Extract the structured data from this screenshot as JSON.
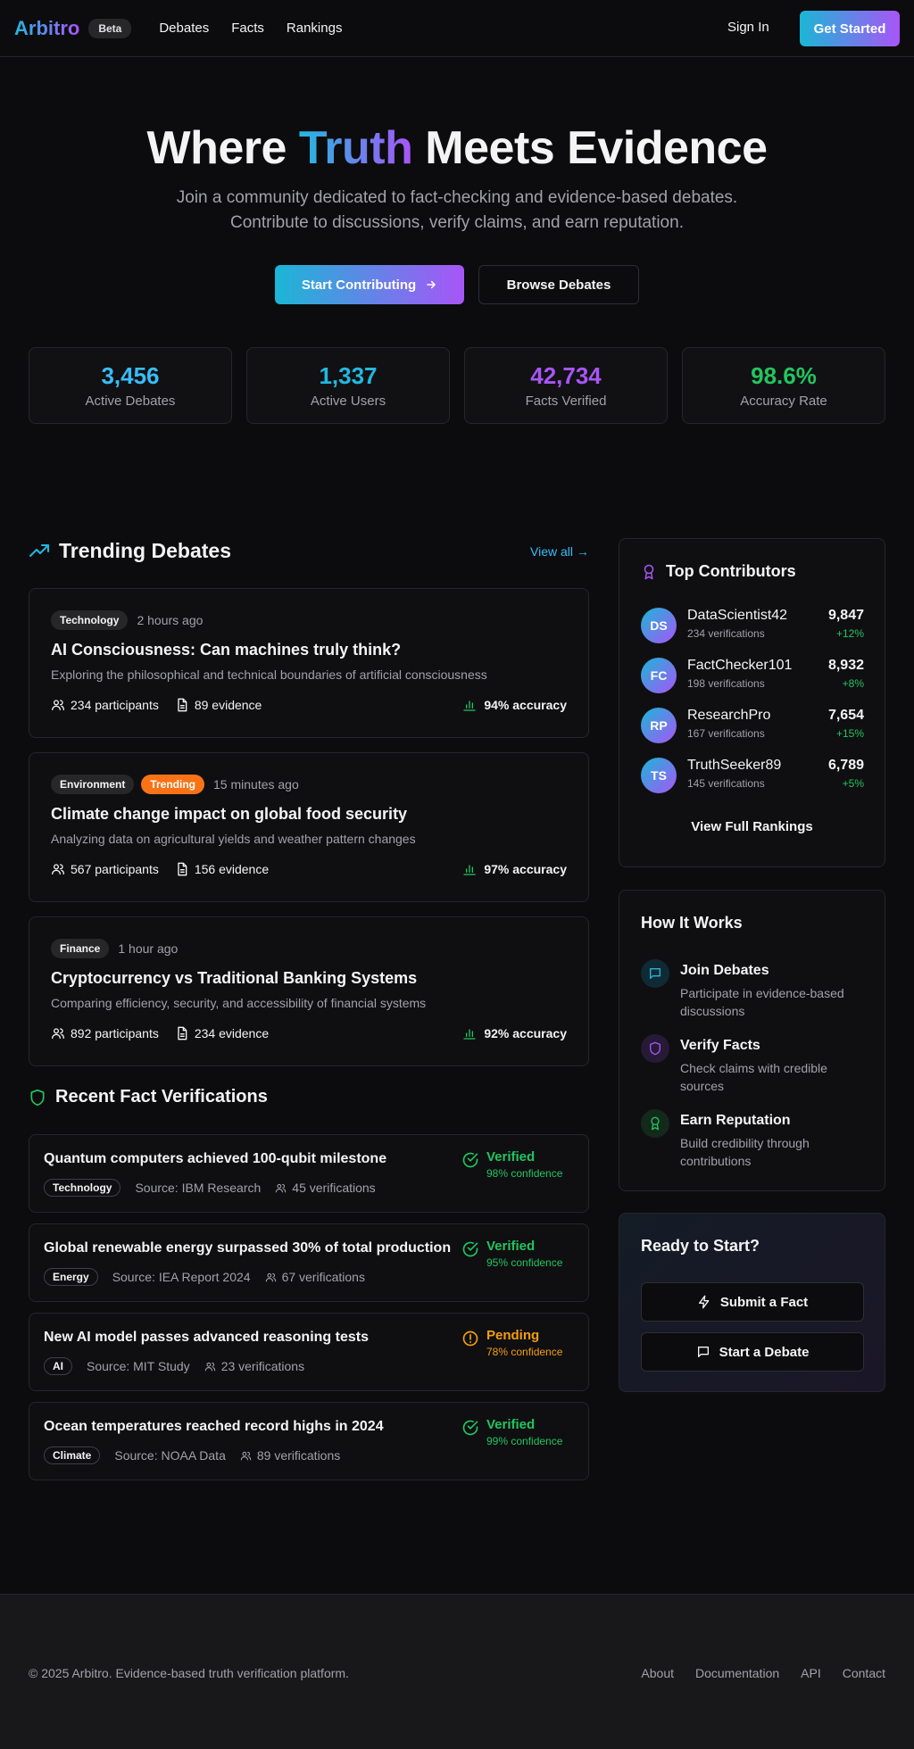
{
  "nav": {
    "logo": "Arbitro",
    "badge": "Beta",
    "links": [
      "Debates",
      "Facts",
      "Rankings"
    ],
    "sign_in": "Sign In",
    "get_started": "Get Started"
  },
  "hero": {
    "title_pre": "Where ",
    "title_accent": "Truth",
    "title_post": " Meets Evidence",
    "subtitle": "Join a community dedicated to fact-checking and evidence-based debates. Contribute to discussions, verify claims, and earn reputation.",
    "primary_cta": "Start Contributing",
    "secondary_cta": "Browse Debates"
  },
  "stats": [
    {
      "value": "3,456",
      "label": "Active Debates",
      "color": "#38bdf8"
    },
    {
      "value": "1,337",
      "label": "Active Users",
      "color": "#22b8e0"
    },
    {
      "value": "42,734",
      "label": "Facts Verified",
      "color": "#a855f7"
    },
    {
      "value": "98.6%",
      "label": "Accuracy Rate",
      "color": "#22c55e"
    }
  ],
  "trending": {
    "title": "Trending Debates",
    "view_all": "View all →",
    "debates": [
      {
        "tags": [
          "Technology"
        ],
        "time": "2 hours ago",
        "title": "AI Consciousness: Can machines truly think?",
        "desc": "Exploring the philosophical and technical boundaries of artificial consciousness",
        "participants": "234 participants",
        "evidence": "89 evidence",
        "accuracy": "94% accuracy"
      },
      {
        "tags": [
          "Environment",
          "Trending"
        ],
        "time": "15 minutes ago",
        "title": "Climate change impact on global food security",
        "desc": "Analyzing data on agricultural yields and weather pattern changes",
        "participants": "567 participants",
        "evidence": "156 evidence",
        "accuracy": "97% accuracy"
      },
      {
        "tags": [
          "Finance"
        ],
        "time": "1 hour ago",
        "title": "Cryptocurrency vs Traditional Banking Systems",
        "desc": "Comparing efficiency, security, and accessibility of financial systems",
        "participants": "892 participants",
        "evidence": "234 evidence",
        "accuracy": "92% accuracy"
      }
    ]
  },
  "facts": {
    "title": "Recent Fact Verifications",
    "items": [
      {
        "title": "Quantum computers achieved 100-qubit milestone",
        "tag": "Technology",
        "source": "Source: IBM Research",
        "verifications": "45 verifications",
        "status": "Verified",
        "confidence": "98% confidence",
        "color": "#22c55e"
      },
      {
        "title": "Global renewable energy surpassed 30% of total production",
        "tag": "Energy",
        "source": "Source: IEA Report 2024",
        "verifications": "67 verifications",
        "status": "Verified",
        "confidence": "95% confidence",
        "color": "#22c55e"
      },
      {
        "title": "New AI model passes advanced reasoning tests",
        "tag": "AI",
        "source": "Source: MIT Study",
        "verifications": "23 verifications",
        "status": "Pending",
        "confidence": "78% confidence",
        "color": "#f59e0b"
      },
      {
        "title": "Ocean temperatures reached record highs in 2024",
        "tag": "Climate",
        "source": "Source: NOAA Data",
        "verifications": "89 verifications",
        "status": "Verified",
        "confidence": "99% confidence",
        "color": "#22c55e"
      }
    ]
  },
  "contributors": {
    "title": "Top Contributors",
    "items": [
      {
        "initials": "DS",
        "name": "DataScientist42",
        "sub": "234 verifications",
        "score": "9,847",
        "delta": "+12%"
      },
      {
        "initials": "FC",
        "name": "FactChecker101",
        "sub": "198 verifications",
        "score": "8,932",
        "delta": "+8%"
      },
      {
        "initials": "RP",
        "name": "ResearchPro",
        "sub": "167 verifications",
        "score": "7,654",
        "delta": "+15%"
      },
      {
        "initials": "TS",
        "name": "TruthSeeker89",
        "sub": "145 verifications",
        "score": "6,789",
        "delta": "+5%"
      }
    ],
    "view_full": "View Full Rankings"
  },
  "how": {
    "title": "How It Works",
    "steps": [
      {
        "title": "Join Debates",
        "desc": "Participate in evidence-based discussions",
        "icon": "chat-icon",
        "color": "#22b8e0"
      },
      {
        "title": "Verify Facts",
        "desc": "Check claims with credible sources",
        "icon": "shield-icon",
        "color": "#a855f7"
      },
      {
        "title": "Earn Reputation",
        "desc": "Build credibility through contributions",
        "icon": "award-icon",
        "color": "#22c55e"
      }
    ]
  },
  "cta": {
    "title": "Ready to Start?",
    "submit_fact": "Submit a Fact",
    "start_debate": "Start a Debate"
  },
  "footer": {
    "copyright": "© 2025 Arbitro. Evidence-based truth verification platform.",
    "links": [
      "About",
      "Documentation",
      "API",
      "Contact"
    ]
  }
}
